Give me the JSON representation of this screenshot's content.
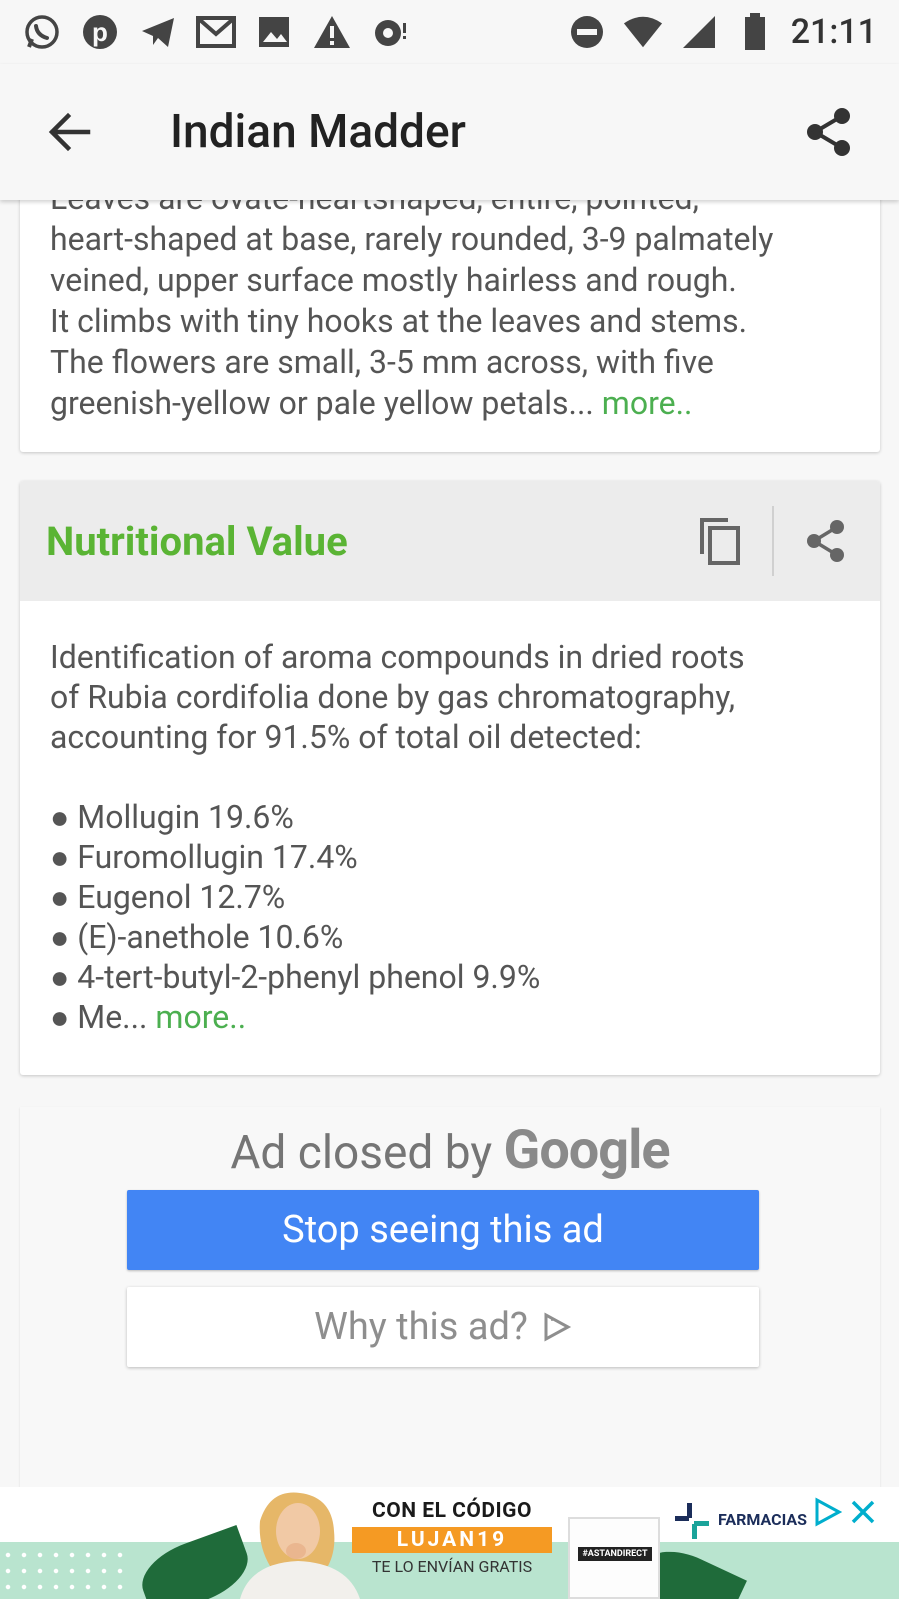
{
  "status_bar": {
    "time": "21:11",
    "left_icons": [
      "whatsapp-icon",
      "pinterest-icon",
      "telegram-icon",
      "gmail-icon",
      "gallery-icon",
      "warning-icon",
      "dot-notification-icon"
    ],
    "right_icons": [
      "do-not-disturb-icon",
      "wifi-icon",
      "signal-icon",
      "battery-icon"
    ]
  },
  "app_bar": {
    "title": "Indian Madder"
  },
  "description_card": {
    "partial_first_line": "Leaves are ovate-heartshaped, entire, pointed,",
    "lines": [
      "heart-shaped at base, rarely rounded, 3-9 palmately",
      "veined, upper surface mostly hairless and rough.",
      "It climbs with tiny hooks at the leaves and stems.",
      "The flowers are small, 3-5 mm across, with five"
    ],
    "last_line": "greenish-yellow or pale yellow petals...",
    "more_label": "more.."
  },
  "nutrition_card": {
    "title": "Nutritional Value",
    "intro_lines": [
      "Identification of aroma compounds in dried roots",
      "of Rubia cordifolia done by gas chromatography,",
      "accounting for 91.5% of total oil detected:"
    ],
    "bullets": [
      "● Mollugin 19.6%",
      "● Furomollugin 17.4%",
      "● Eugenol 12.7%",
      "● (E)-anethole 10.6%",
      "● 4-tert-butyl-2-phenyl phenol 9.9%"
    ],
    "last_bullet": "● Me...",
    "more_label": "more.."
  },
  "ad_closed": {
    "prefix": "Ad closed by",
    "brand": "Google",
    "stop_label": "Stop seeing this ad",
    "why_label": "Why this ad?"
  },
  "banner": {
    "line1": "CON EL CÓDIGO",
    "code": "LUJAN19",
    "line3": "TE LO ENVÍAN GRATIS",
    "bag_text": "#ASTANDIRECT",
    "brand": "FARMACIAS"
  },
  "colors": {
    "accent_green": "#5ab434",
    "link_green": "#4caf50",
    "google_blue": "#4285f4",
    "promo_orange": "#f59a23"
  }
}
